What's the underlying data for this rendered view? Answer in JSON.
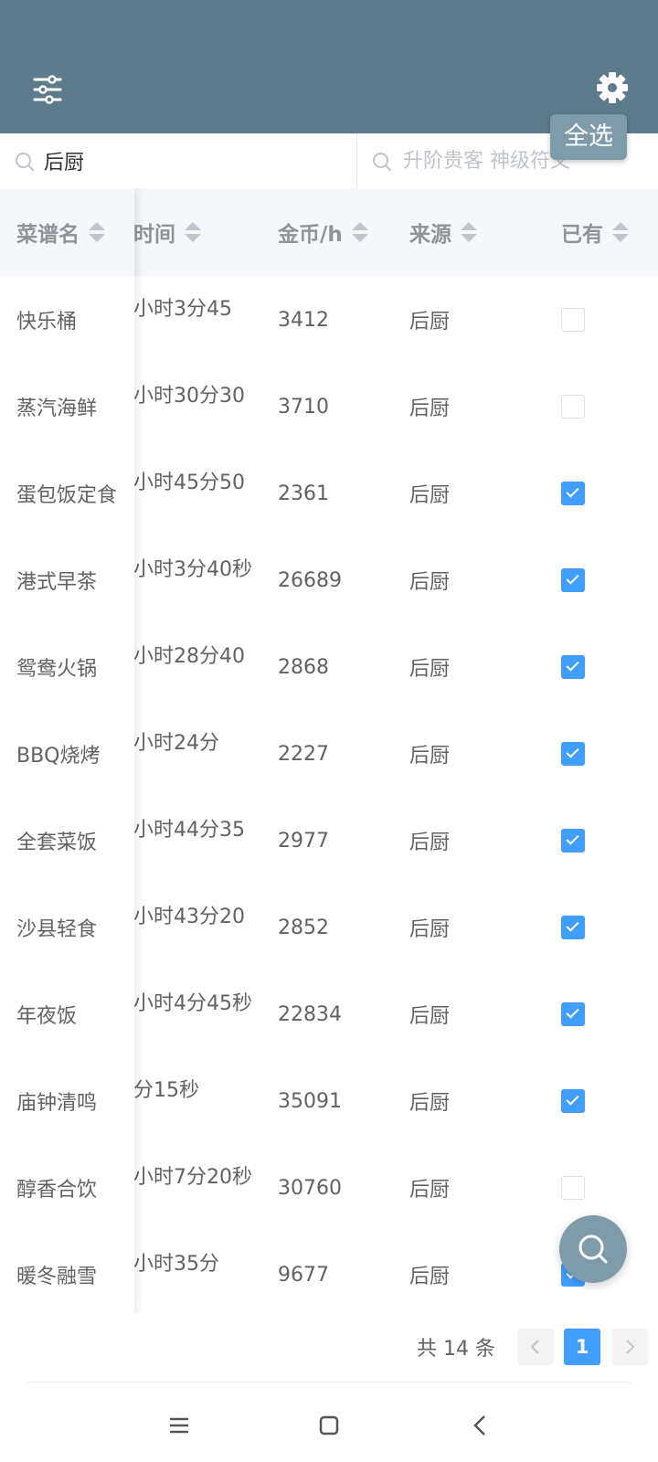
{
  "header": {
    "select_all_label": "全选"
  },
  "search": {
    "left_value": "后厨",
    "right_placeholder": "升阶贵客 神级符文"
  },
  "table": {
    "columns": [
      "菜谱名",
      "时间",
      "金币/h",
      "来源",
      "已有"
    ],
    "rows": [
      {
        "name": "快乐桶",
        "time": "小时3分45",
        "gold": "3412",
        "source": "后厨",
        "owned": false
      },
      {
        "name": "蒸汽海鲜",
        "time": "小时30分30",
        "gold": "3710",
        "source": "后厨",
        "owned": false
      },
      {
        "name": "蛋包饭定食",
        "time": "小时45分50",
        "gold": "2361",
        "source": "后厨",
        "owned": true
      },
      {
        "name": "港式早茶",
        "time": "小时3分40秒",
        "gold": "26689",
        "source": "后厨",
        "owned": true
      },
      {
        "name": "鸳鸯火锅",
        "time": "小时28分40",
        "gold": "2868",
        "source": "后厨",
        "owned": true
      },
      {
        "name": "BBQ烧烤",
        "time": "小时24分",
        "gold": "2227",
        "source": "后厨",
        "owned": true
      },
      {
        "name": "全套菜饭",
        "time": "小时44分35",
        "gold": "2977",
        "source": "后厨",
        "owned": true
      },
      {
        "name": "沙县轻食",
        "time": "小时43分20",
        "gold": "2852",
        "source": "后厨",
        "owned": true
      },
      {
        "name": "年夜饭",
        "time": "小时4分45秒",
        "gold": "22834",
        "source": "后厨",
        "owned": true
      },
      {
        "name": "庙钟清鸣",
        "time": "分15秒",
        "gold": "35091",
        "source": "后厨",
        "owned": true
      },
      {
        "name": "醇香合饮",
        "time": "小时7分20秒",
        "gold": "30760",
        "source": "后厨",
        "owned": false
      },
      {
        "name": "暖冬融雪",
        "time": "小时35分",
        "gold": "9677",
        "source": "后厨",
        "owned": true
      }
    ]
  },
  "pager": {
    "total_text": "共 14 条",
    "current_page": "1"
  },
  "icons": {
    "filter": "sliders-icon",
    "settings": "gear-icon",
    "search": "search-icon",
    "fab": "search-icon"
  },
  "colors": {
    "topbar": "#5e7b8c",
    "accent": "#409eff",
    "fab": "#7f9aa8"
  }
}
